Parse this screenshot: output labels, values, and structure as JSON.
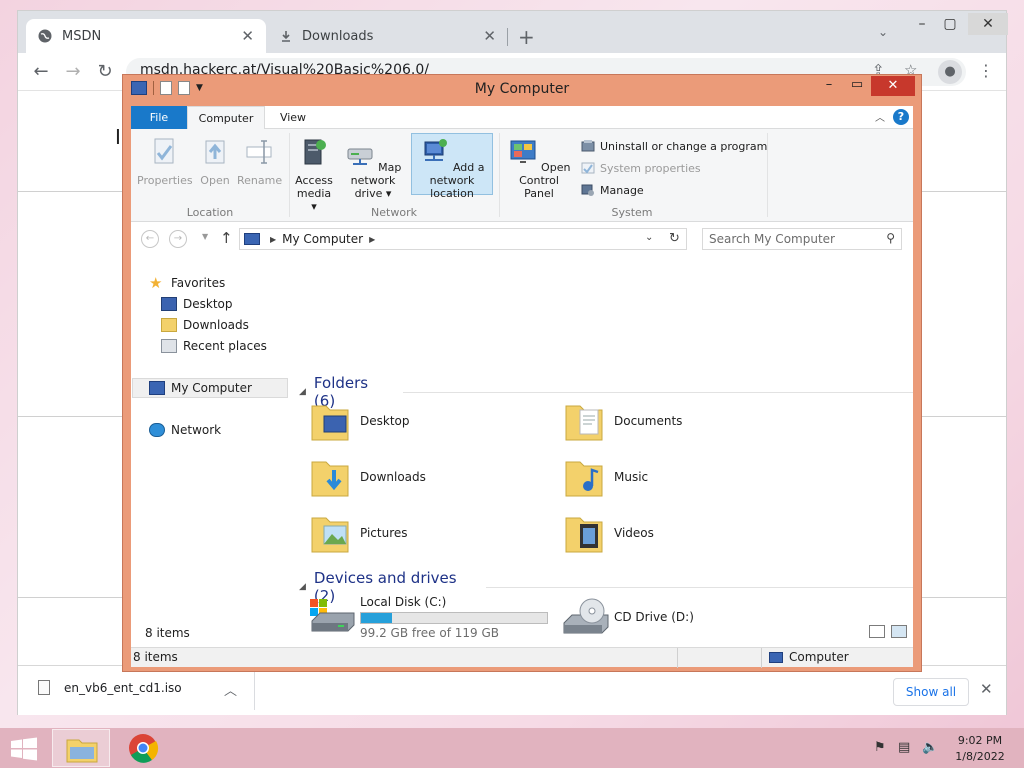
{
  "browser": {
    "tabs": [
      {
        "label": "MSDN",
        "icon": "globe-icon"
      },
      {
        "label": "Downloads",
        "icon": "download-icon"
      }
    ],
    "url": "msdn.hackerc.at/Visual%20Basic%206.0/",
    "download": {
      "filename": "en_vb6_ent_cd1.iso",
      "show_all": "Show all"
    }
  },
  "explorer": {
    "title": "My Computer",
    "ribbon_tabs": [
      "File",
      "Computer",
      "View"
    ],
    "ribbon": {
      "location": {
        "label": "Location",
        "buttons": [
          "Properties",
          "Open",
          "Rename"
        ]
      },
      "network": {
        "label": "Network",
        "access_media": [
          "Access",
          "media ▾"
        ],
        "map_drive": [
          "Map network",
          "drive ▾"
        ],
        "add_location": [
          "Add a network",
          "location"
        ]
      },
      "system": {
        "label": "System",
        "open_cp": [
          "Open Control",
          "Panel"
        ],
        "uninstall": "Uninstall or change a program",
        "sys_props": "System properties",
        "manage": "Manage"
      }
    },
    "address": {
      "crumb": "My Computer",
      "search_placeholder": "Search My Computer"
    },
    "nav": {
      "favorites": "Favorites",
      "desktop": "Desktop",
      "downloads": "Downloads",
      "recent": "Recent places",
      "computer": "My Computer",
      "network": "Network"
    },
    "folders_header": "Folders (6)",
    "folders": [
      "Desktop",
      "Documents",
      "Downloads",
      "Music",
      "Pictures",
      "Videos"
    ],
    "devices_header": "Devices and drives (2)",
    "drives": {
      "c_name": "Local Disk (C:)",
      "c_free": "99.2 GB free of 119 GB",
      "c_used_fraction": 0.166,
      "d_name": "CD Drive (D:)"
    },
    "item_count": "8 items",
    "status_left": "8 items",
    "status_right": "Computer"
  },
  "taskbar": {
    "time": "9:02 PM",
    "date": "1/8/2022"
  }
}
